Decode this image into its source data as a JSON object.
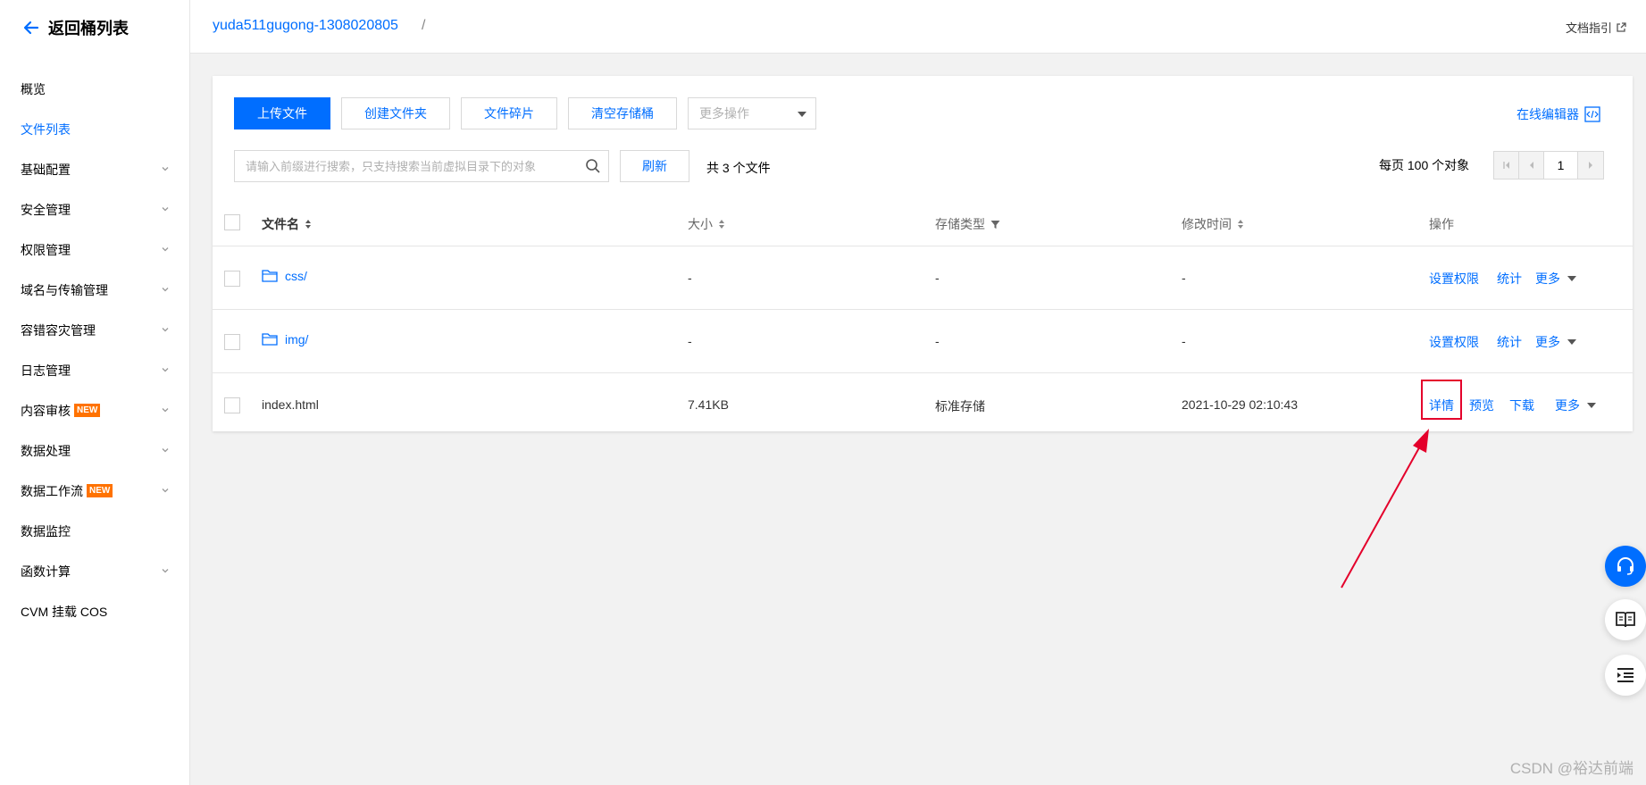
{
  "sidebar": {
    "back_label": "返回桶列表",
    "items": [
      {
        "label": "概览",
        "expandable": false
      },
      {
        "label": "文件列表",
        "expandable": false,
        "active": true
      },
      {
        "label": "基础配置",
        "expandable": true
      },
      {
        "label": "安全管理",
        "expandable": true
      },
      {
        "label": "权限管理",
        "expandable": true
      },
      {
        "label": "域名与传输管理",
        "expandable": true
      },
      {
        "label": "容错容灾管理",
        "expandable": true
      },
      {
        "label": "日志管理",
        "expandable": true
      },
      {
        "label": "内容审核",
        "expandable": true,
        "badge": "NEW"
      },
      {
        "label": "数据处理",
        "expandable": true
      },
      {
        "label": "数据工作流",
        "expandable": true,
        "badge": "NEW"
      },
      {
        "label": "数据监控",
        "expandable": false
      },
      {
        "label": "函数计算",
        "expandable": true
      },
      {
        "label": "CVM 挂载 COS",
        "expandable": false
      }
    ]
  },
  "topbar": {
    "bucket_name": "yuda511gugong-1308020805",
    "separator": "/",
    "doc_link": "文档指引"
  },
  "toolbar": {
    "upload": "上传文件",
    "create_folder": "创建文件夹",
    "fragments": "文件碎片",
    "clear_bucket": "清空存储桶",
    "more_ops": "更多操作",
    "online_editor": "在线编辑器"
  },
  "search": {
    "placeholder": "请输入前缀进行搜索，只支持搜索当前虚拟目录下的对象",
    "refresh": "刷新",
    "total": "共 3 个文件"
  },
  "pagination": {
    "per_page": "每页 100 个对象",
    "current_page": "1"
  },
  "table": {
    "columns": {
      "name": "文件名",
      "size": "大小",
      "storage": "存储类型",
      "modified": "修改时间",
      "actions": "操作"
    },
    "rows": [
      {
        "name": "css/",
        "is_folder": true,
        "size": "-",
        "storage": "-",
        "modified": "-",
        "actions": [
          "设置权限",
          "统计",
          "更多"
        ]
      },
      {
        "name": "img/",
        "is_folder": true,
        "size": "-",
        "storage": "-",
        "modified": "-",
        "actions": [
          "设置权限",
          "统计",
          "更多"
        ]
      },
      {
        "name": "index.html",
        "is_folder": false,
        "size": "7.41KB",
        "storage": "标准存储",
        "modified": "2021-10-29 02:10:43",
        "actions": [
          "详情",
          "预览",
          "下载",
          "更多"
        ]
      }
    ]
  },
  "colors": {
    "accent": "#006eff",
    "badge": "#ff7200",
    "annotation": "#e4002b"
  },
  "watermark": "CSDN @裕达前端"
}
